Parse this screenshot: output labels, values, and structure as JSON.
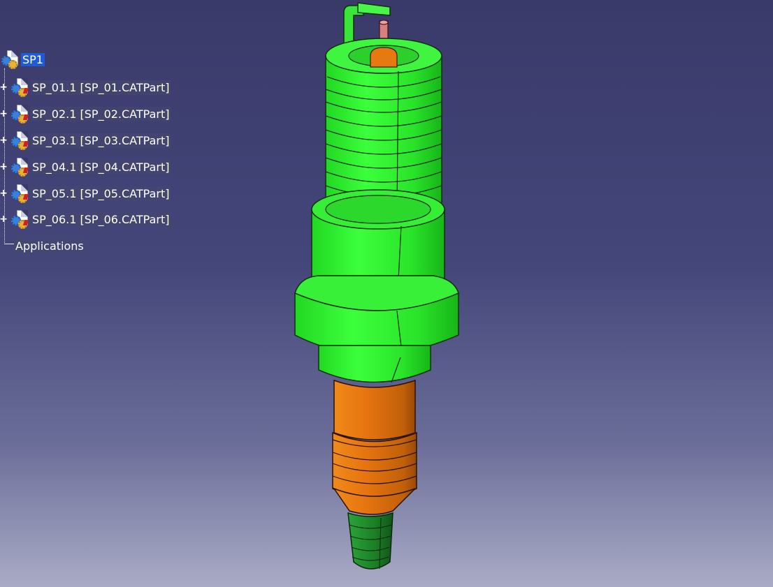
{
  "tree": {
    "root": {
      "label": "SP1",
      "icon": "product-icon"
    },
    "children": [
      {
        "label": "SP_01.1 [SP_01.CATPart]",
        "icon": "part-icon"
      },
      {
        "label": "SP_02.1 [SP_02.CATPart]",
        "icon": "part-icon"
      },
      {
        "label": "SP_03.1 [SP_03.CATPart]",
        "icon": "part-icon"
      },
      {
        "label": "SP_04.1 [SP_04.CATPart]",
        "icon": "part-icon"
      },
      {
        "label": "SP_05.1 [SP_05.CATPart]",
        "icon": "part-icon"
      },
      {
        "label": "SP_06.1 [SP_06.CATPart]",
        "icon": "part-icon"
      }
    ],
    "applications": "Applications"
  },
  "model": {
    "name": "spark-plug",
    "colors": {
      "shell": "#2cf02c",
      "shell_dark": "#1aa81a",
      "insulator": "#e67a10",
      "insulator_dark": "#a85008",
      "tip": "#1f8f2a",
      "electrode": "#d88080"
    }
  }
}
